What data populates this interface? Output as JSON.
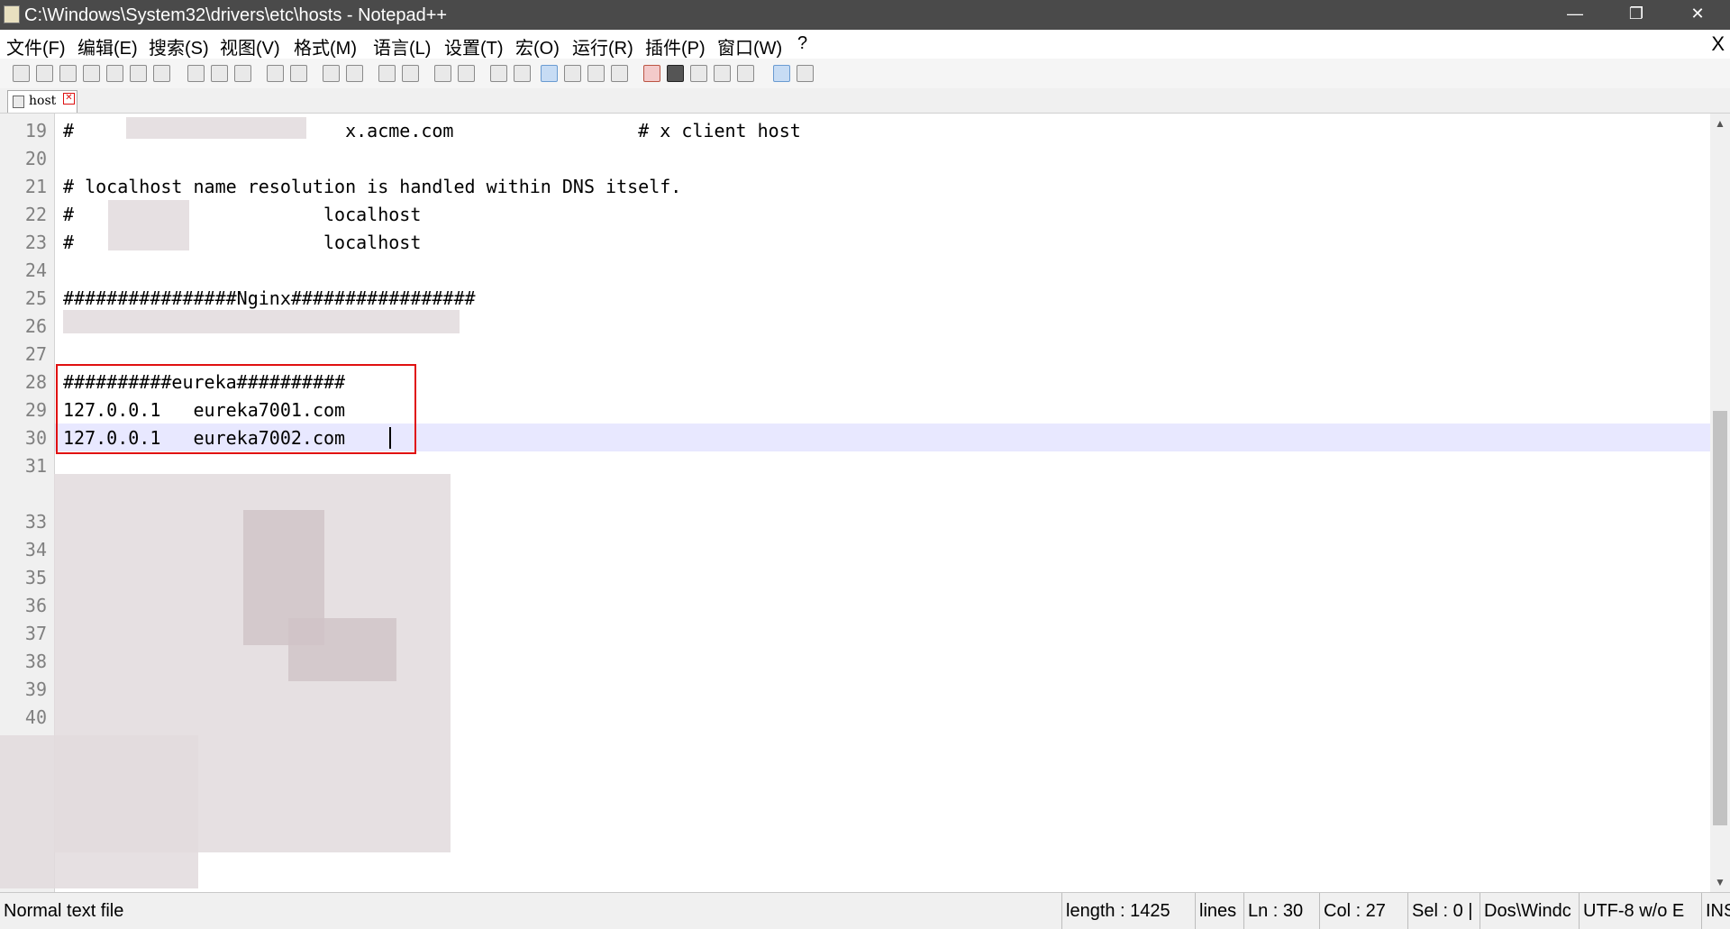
{
  "window": {
    "title": "C:\\Windows\\System32\\drivers\\etc\\hosts - Notepad++",
    "minimize_glyph": "—",
    "maximize_glyph": "❐",
    "close_glyph": "✕"
  },
  "menu": {
    "items": [
      "文件(F)",
      "编辑(E)",
      "搜索(S)",
      "视图(V)",
      "格式(M)",
      "语言(L)",
      "设置(T)",
      "宏(O)",
      "运行(R)",
      "插件(P)",
      "窗口(W)",
      "?"
    ],
    "close_label": "X"
  },
  "tabs": [
    {
      "label": "host"
    }
  ],
  "editor": {
    "lines": [
      {
        "num": "19",
        "text": "#                         x.acme.com                 # x client host"
      },
      {
        "num": "20",
        "text": ""
      },
      {
        "num": "21",
        "text": "# localhost name resolution is handled within DNS itself."
      },
      {
        "num": "22",
        "text": "#                       localhost"
      },
      {
        "num": "23",
        "text": "#                       localhost"
      },
      {
        "num": "24",
        "text": ""
      },
      {
        "num": "25",
        "text": "################Nginx#################"
      },
      {
        "num": "26",
        "text": ""
      },
      {
        "num": "27",
        "text": ""
      },
      {
        "num": "28",
        "text": "##########eureka##########"
      },
      {
        "num": "29",
        "text": "127.0.0.1   eureka7001.com"
      },
      {
        "num": "30",
        "text": "127.0.0.1   eureka7002.com"
      },
      {
        "num": "31",
        "text": ""
      },
      {
        "num": "",
        "text": ""
      },
      {
        "num": "33",
        "text": ""
      },
      {
        "num": "34",
        "text": ""
      },
      {
        "num": "35",
        "text": ""
      },
      {
        "num": "36",
        "text": ""
      },
      {
        "num": "37",
        "text": ""
      },
      {
        "num": "38",
        "text": ""
      },
      {
        "num": "39",
        "text": ""
      },
      {
        "num": "40",
        "text": ""
      }
    ],
    "current_line": "30"
  },
  "status": {
    "file_type": "Normal text file",
    "length": "length : 1425",
    "lines": "lines",
    "ln": "Ln : 30",
    "col": "Col : 27",
    "sel": "Sel : 0 |",
    "eol": "Dos\\Windc",
    "encoding": "UTF-8 w/o E",
    "ins": "INS"
  },
  "colors": {
    "titlebar": "#4a4a4a",
    "highlight_box": "#e01010",
    "current_line": "#e8e8ff"
  }
}
